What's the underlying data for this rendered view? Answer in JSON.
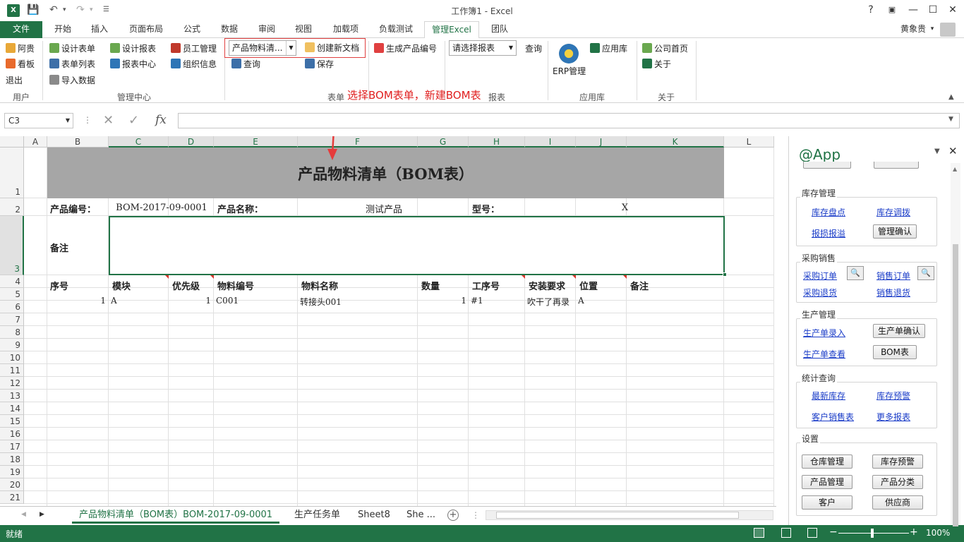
{
  "window": {
    "title": "工作簿1 - Excel",
    "help": "?",
    "user": "黄象贵"
  },
  "tabs": [
    "文件",
    "开始",
    "插入",
    "页面布局",
    "公式",
    "数据",
    "审阅",
    "视图",
    "加载项",
    "负载测试",
    "管理Excel",
    "团队"
  ],
  "ribbon": {
    "user_group": {
      "items": [
        "阿贵",
        "看板",
        "退出"
      ],
      "label": "用户"
    },
    "manage_group": {
      "items": [
        "设计表单",
        "表单列表",
        "导入数据",
        "设计报表",
        "报表中心",
        "员工管理",
        "组织信息"
      ],
      "label": "管理中心"
    },
    "form_group": {
      "combo": "产品物料清...",
      "create": "创建新文档",
      "query": "查询",
      "save": "保存",
      "label": "表单"
    },
    "gen": "生成产品编号",
    "report_group": {
      "combo": "请选择报表",
      "query": "查询",
      "label": "报表"
    },
    "app_group": {
      "erp": "ERP管理",
      "applib": "应用库",
      "label": "应用库"
    },
    "about_group": {
      "home": "公司首页",
      "about": "关于",
      "label": "关于"
    },
    "annotation": "选择BOM表单，新建BOM表"
  },
  "formula_bar": {
    "namebox": "C3",
    "fx": "fx"
  },
  "columns": [
    "A",
    "B",
    "C",
    "D",
    "E",
    "F",
    "G",
    "H",
    "I",
    "J",
    "K",
    "L"
  ],
  "rows": [
    "1",
    "2",
    "3",
    "4",
    "5",
    "6",
    "7",
    "8",
    "9",
    "10",
    "11",
    "12",
    "13",
    "14",
    "15",
    "16",
    "17",
    "18",
    "19",
    "20",
    "21"
  ],
  "sheet": {
    "title": "产品物料清单（BOM表）",
    "code_label": "产品编号：",
    "code_value": "BOM-2017-09-0001",
    "name_label": "产品名称：",
    "name_value": "测试产品",
    "model_label": "型号：",
    "model_value": "X",
    "remark_label": "备注",
    "headers": [
      "序号",
      "模块",
      "优先级",
      "物料编号",
      "物料名称",
      "数量",
      "工序号",
      "安装要求",
      "位置",
      "备注"
    ],
    "row5": [
      "1",
      "A",
      "1",
      "C001",
      "转接头001",
      "1",
      "#1",
      "吹干了再录",
      "A",
      ""
    ]
  },
  "sheet_tabs": [
    "产品物料清单（BOM表）BOM-2017-09-0001",
    "生产任务单",
    "Sheet8",
    "She ..."
  ],
  "status": {
    "ready": "就绪",
    "zoom": "100%"
  },
  "pane": {
    "title": "@App",
    "inventory": {
      "label": "库存管理",
      "links": [
        "库存盘点",
        "库存调拨",
        "报损报溢"
      ],
      "button": "管理确认"
    },
    "purchase": {
      "label": "采购销售",
      "links": [
        "采购订单",
        "销售订单",
        "采购退货",
        "销售退货"
      ]
    },
    "production": {
      "label": "生产管理",
      "links": [
        "生产单录入",
        "生产单查看"
      ],
      "buttons": [
        "生产单确认",
        "BOM表"
      ]
    },
    "stats": {
      "label": "统计查询",
      "links": [
        "最新库存",
        "库存预警",
        "客户销售表",
        "更多报表"
      ]
    },
    "settings": {
      "label": "设置",
      "buttons": [
        "仓库管理",
        "库存预警",
        "产品管理",
        "产品分类",
        "客户",
        "供应商"
      ]
    }
  }
}
